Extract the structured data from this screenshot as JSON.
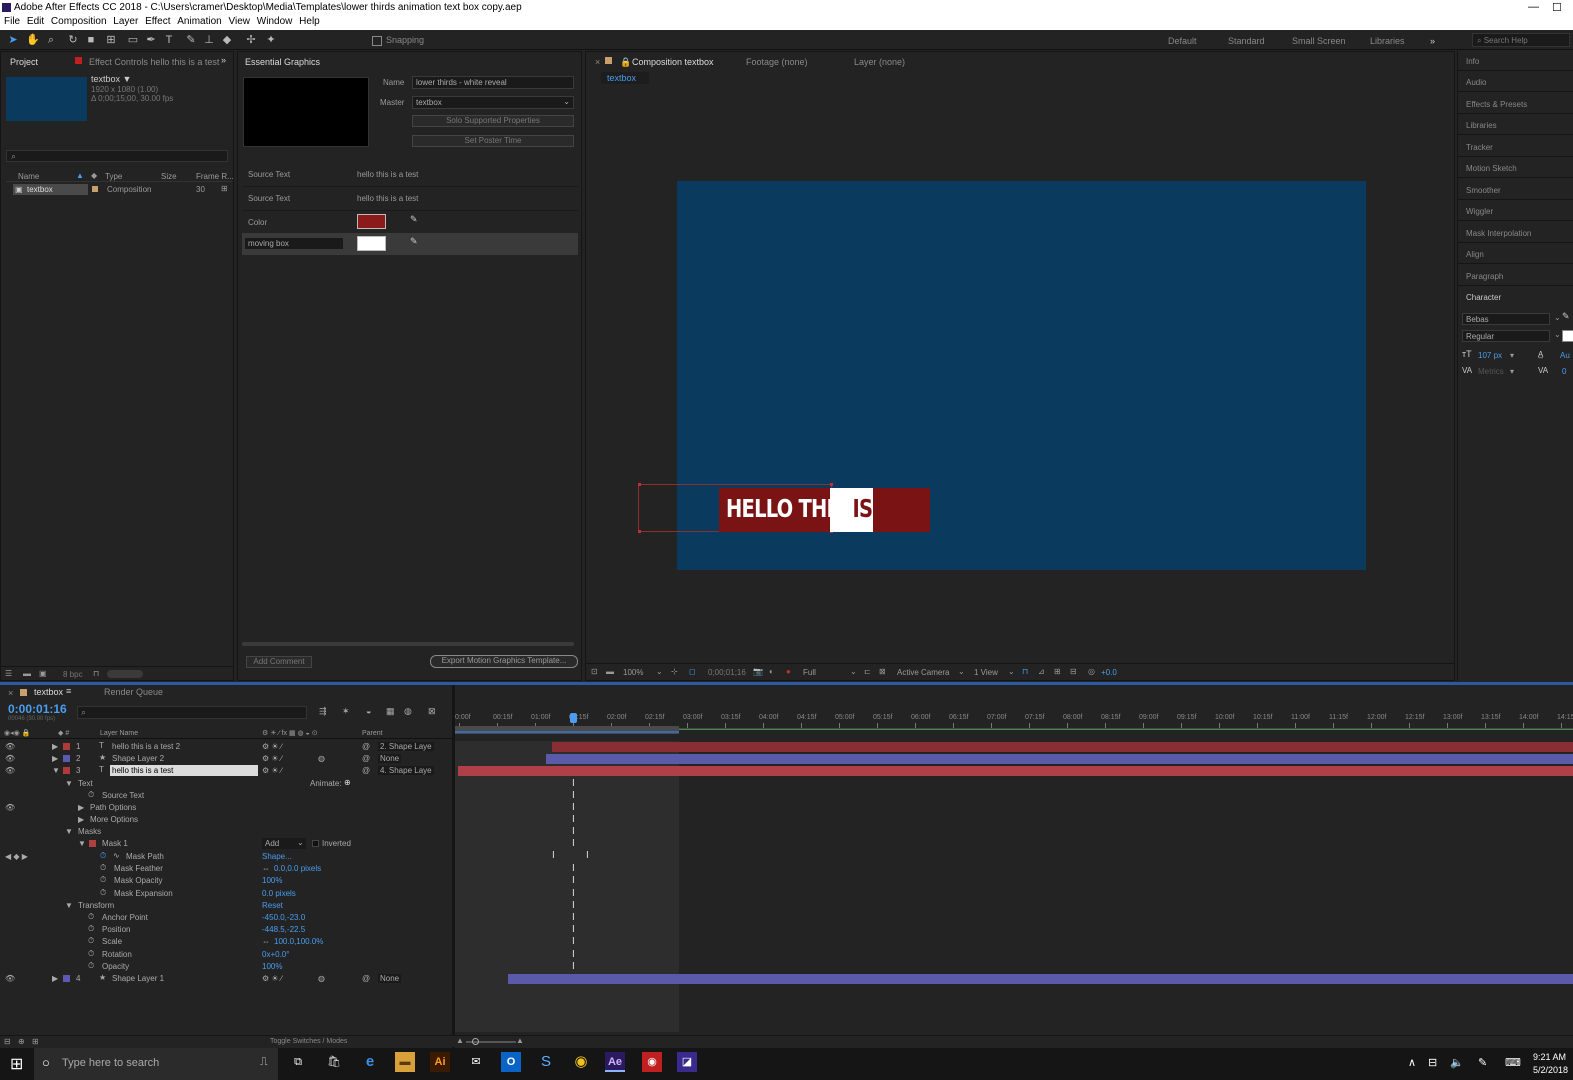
{
  "window": {
    "title": "Adobe After Effects CC 2018 - C:\\Users\\cramer\\Desktop\\Media\\Templates\\lower thirds animation text box copy.aep",
    "min": "—",
    "max": "☐",
    "close": "✕"
  },
  "menu": [
    "File",
    "Edit",
    "Composition",
    "Layer",
    "Effect",
    "Animation",
    "View",
    "Window",
    "Help"
  ],
  "toolbar": {
    "snapping": "Snapping",
    "workspaces": [
      "Default",
      "Standard",
      "Small Screen",
      "Libraries"
    ],
    "overflow": "»",
    "search_placeholder": "Search Help"
  },
  "project": {
    "tab": "Project",
    "effect_controls_tab": "Effect Controls hello this is a test",
    "item_name": "textbox ▼",
    "item_info1": "1920 x 1080 (1.00)",
    "item_info2": "Δ 0;00;15;00, 30.00 fps",
    "search_icon": "⌕",
    "col_name": "Name",
    "col_type": "Type",
    "col_size": "Size",
    "col_frame": "Frame R...",
    "row_name": "textbox",
    "row_type": "Composition",
    "row_frame": "30",
    "bpc": "8 bpc"
  },
  "essential_graphics": {
    "tab": "Essential Graphics",
    "name_label": "Name",
    "name_value": "lower thirds - white reveal",
    "master_label": "Master",
    "master_value": "textbox",
    "solo_btn": "Solo Supported Properties",
    "poster_btn": "Set Poster Time",
    "props": [
      {
        "label": "Source Text",
        "value": "hello this is a test"
      },
      {
        "label": "Source Text",
        "value": "hello this is a test"
      }
    ],
    "color_label": "Color",
    "color_value": "#8b1a1a",
    "moving_box_label": "moving box",
    "moving_box_color": "#ffffff",
    "add_comment": "Add Comment",
    "export_btn": "Export Motion Graphics Template..."
  },
  "composition": {
    "tab": "Composition textbox",
    "footage_tab": "Footage (none)",
    "layer_tab": "Layer (none)",
    "sub_tab": "textbox",
    "bg_color": "#0a3a5e",
    "box_color": "#7a1414",
    "reveal_color": "#ffffff",
    "text_part1": "HELLO THIS",
    "text_part2": "IS A",
    "zoom": "100%",
    "timecode": "0;00;01;16",
    "resolution": "Full",
    "camera": "Active Camera",
    "views": "1 View",
    "exposure": "+0.0"
  },
  "right_panels": [
    "Info",
    "Audio",
    "Effects & Presets",
    "Libraries",
    "Tracker",
    "Motion Sketch",
    "Smoother",
    "Wiggler",
    "Mask Interpolation",
    "Align",
    "Paragraph"
  ],
  "character": {
    "title": "Character",
    "font": "Bebas",
    "style": "Regular",
    "size": "107 px",
    "kerning": "Metrics",
    "leading": "Au",
    "tracking": "0"
  },
  "timeline": {
    "tab": "textbox",
    "render_tab": "Render Queue",
    "timecode": "0:00:01:16",
    "subtime": "00046 (30.00 fps)",
    "col_layer_name": "Layer Name",
    "col_parent": "Parent",
    "ruler": [
      "0:00f",
      "00:15f",
      "01:00f",
      "01:15f",
      "02:00f",
      "02:15f",
      "03:00f",
      "03:15f",
      "04:00f",
      "04:15f",
      "05:00f",
      "05:15f",
      "06:00f",
      "06:15f",
      "07:00f",
      "07:15f",
      "08:00f",
      "08:15f",
      "09:00f",
      "09:15f",
      "10:00f",
      "10:15f",
      "11:00f",
      "11:15f",
      "12:00f",
      "12:15f",
      "13:00f",
      "13:15f",
      "14:00f",
      "14:15f"
    ],
    "layers": [
      {
        "num": "1",
        "type": "T",
        "name": "hello this is a test 2",
        "parent": "2. Shape Laye",
        "color": "#b03a3a"
      },
      {
        "num": "2",
        "type": "★",
        "name": "Shape Layer 2",
        "parent": "None",
        "color": "#5a5ab0"
      },
      {
        "num": "3",
        "type": "T",
        "name": "hello this is a test",
        "parent": "4. Shape Laye",
        "color": "#b03a3a"
      }
    ],
    "animate": "Animate:",
    "text_group": "Text",
    "source_text": "Source Text",
    "path_options": "Path Options",
    "more_options": "More Options",
    "masks": "Masks",
    "mask1": "Mask 1",
    "mask_mode": "Add",
    "inverted": "Inverted",
    "mask_props": [
      {
        "label": "Mask Path",
        "value": "Shape..."
      },
      {
        "label": "Mask Feather",
        "value": "0.0,0.0 pixels"
      },
      {
        "label": "Mask Opacity",
        "value": "100%"
      },
      {
        "label": "Mask Expansion",
        "value": "0.0 pixels"
      }
    ],
    "transform": "Transform",
    "reset": "Reset",
    "transform_props": [
      {
        "label": "Anchor Point",
        "value": "-450.0,-23.0"
      },
      {
        "label": "Position",
        "value": "-448.5,-22.5"
      },
      {
        "label": "Scale",
        "value": "100.0,100.0%"
      },
      {
        "label": "Rotation",
        "value": "0x+0.0°"
      },
      {
        "label": "Opacity",
        "value": "100%"
      }
    ],
    "layer4": {
      "num": "4",
      "type": "★",
      "name": "Shape Layer 1",
      "parent": "None",
      "color": "#5a5ab0"
    },
    "toggle": "Toggle Switches / Modes"
  },
  "taskbar": {
    "search_placeholder": "Type here to search",
    "time": "9:21 AM",
    "date": "5/2/2018"
  }
}
